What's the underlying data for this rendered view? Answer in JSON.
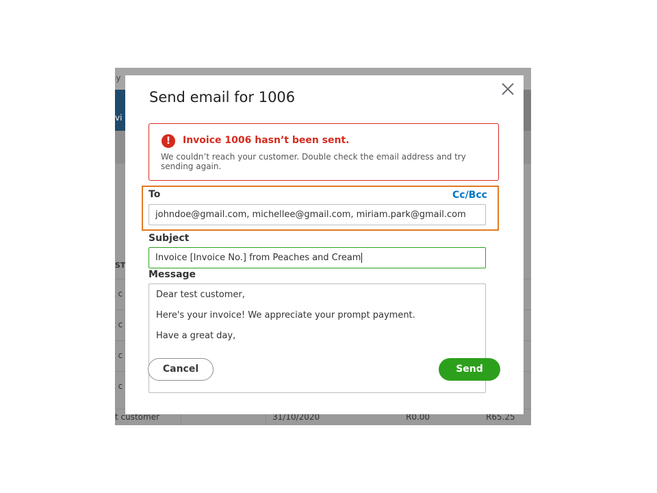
{
  "background": {
    "topbar_text": "ay",
    "header_text": "vi",
    "column_header": "ST",
    "row_fragment": "t c",
    "bottom_row": {
      "customer": "t customer",
      "date": "31/10/2020",
      "amount1": "R0.00",
      "amount2": "R65.25"
    }
  },
  "dialog": {
    "title": "Send email for 1006",
    "close_icon": "close-icon",
    "alert": {
      "icon": "error-icon",
      "icon_glyph": "!",
      "title": "Invoice 1006 hasn’t been sent.",
      "body": "We couldn’t reach your customer. Double check the email address and try sending again."
    },
    "to": {
      "label": "To",
      "cc_bcc_label": "Cc/Bcc",
      "value": "johndoe@gmail.com, michellee@gmail.com, miriam.park@gmail.com"
    },
    "subject": {
      "label": "Subject",
      "value": "Invoice [Invoice No.] from Peaches and Cream"
    },
    "message": {
      "label": "Message",
      "lines": [
        "Dear test customer,",
        "Here's your invoice! We appreciate your prompt payment.",
        "Have a great day,"
      ]
    },
    "buttons": {
      "cancel": "Cancel",
      "send": "Send"
    }
  },
  "colors": {
    "error": "#d52b1e",
    "primary_green": "#2ca01c",
    "link_blue": "#0077c5",
    "highlight_orange": "#e07b22"
  }
}
